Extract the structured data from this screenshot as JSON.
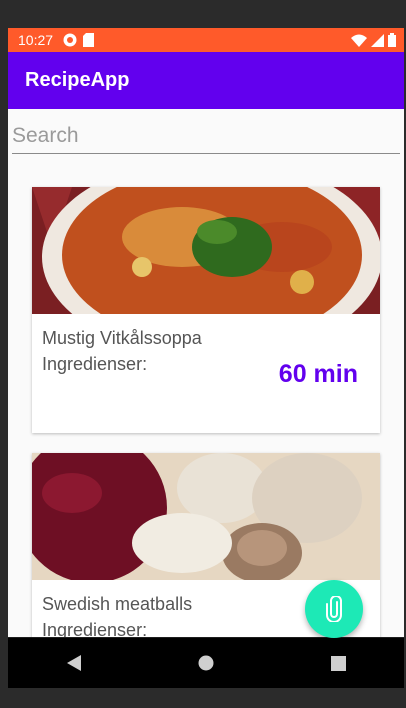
{
  "status_bar": {
    "time": "10:27",
    "icons_left": [
      "notification-icon",
      "sd-card-icon"
    ],
    "icons_right": [
      "wifi-icon",
      "signal-icon",
      "battery-icon"
    ]
  },
  "app_bar": {
    "title": "RecipeApp"
  },
  "search": {
    "placeholder": "Search",
    "value": ""
  },
  "recipes": [
    {
      "name": "Mustig Vitkålssoppa",
      "ingredients_label": "Ingredienser:",
      "time": "60 min",
      "image_icon": "soup-photo"
    },
    {
      "name": "Swedish meatballs",
      "ingredients_label": "Ingredienser:",
      "time": "",
      "image_icon": "meatballs-photo"
    }
  ],
  "fab": {
    "icon": "paperclip-icon"
  },
  "nav_bar": {
    "buttons": [
      "back-icon",
      "home-icon",
      "recents-icon"
    ]
  },
  "colors": {
    "status_bar": "#ff5a2a",
    "app_bar": "#6200ee",
    "accent_text": "#6200ee",
    "fab": "#1de9b6"
  }
}
